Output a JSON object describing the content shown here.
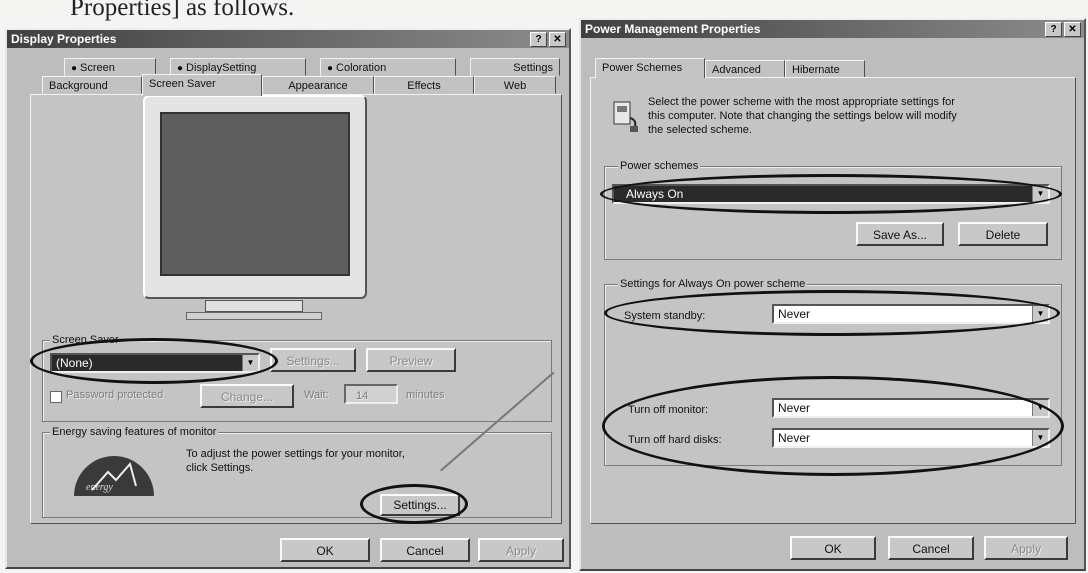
{
  "caption": "Properties] as follows.",
  "display": {
    "title": "Display Properties",
    "tabs_top": [
      "Screen",
      "DisplaySetting",
      "Coloration",
      "Settings"
    ],
    "tabs_bottom": [
      "Background",
      "Screen Saver",
      "Appearance",
      "Effects",
      "Web"
    ],
    "screensaver_group": "Screen Saver",
    "screensaver_value": "(None)",
    "settings_btn_disabled": "Settings...",
    "preview_btn": "Preview",
    "password_protected": "Password protected",
    "change_btn": "Change...",
    "wait_label": "Wait:",
    "wait_value": "14",
    "minutes": "minutes",
    "energy_group": "Energy saving features of monitor",
    "energy_text_1": "To adjust the power settings for your monitor,",
    "energy_text_2": "click Settings.",
    "energy_settings_btn": "Settings...",
    "ok": "OK",
    "cancel": "Cancel",
    "apply": "Apply"
  },
  "power": {
    "title": "Power Management Properties",
    "tabs": [
      "Power Schemes",
      "Advanced",
      "Hibernate"
    ],
    "desc_1": "Select the power scheme with the most appropriate settings for",
    "desc_2": "this computer. Note that changing the settings below will modify",
    "desc_3": "the selected scheme.",
    "schemes_group": "Power schemes",
    "scheme_value": "Always On",
    "save_as": "Save As...",
    "delete": "Delete",
    "settings_group": "Settings for Always On power scheme",
    "standby_label": "System standby:",
    "standby_value": "Never",
    "monitor_label": "Turn off monitor:",
    "monitor_value": "Never",
    "harddisk_label": "Turn off hard disks:",
    "harddisk_value": "Never",
    "ok": "OK",
    "cancel": "Cancel",
    "apply": "Apply"
  }
}
